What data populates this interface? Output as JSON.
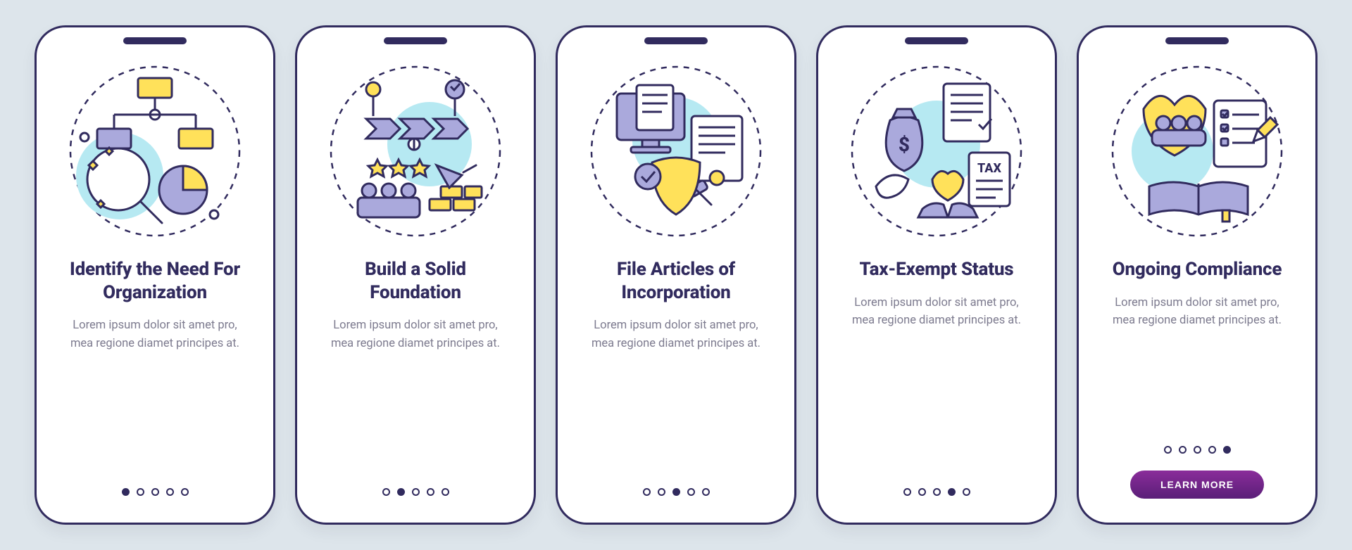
{
  "colors": {
    "ink": "#312b5e",
    "yellow": "#ffe15a",
    "lavender": "#aaa9dc",
    "cyan": "#b6e9f2",
    "page_bg": "#dde5eb",
    "cta_gradient_top": "#8a2d9a",
    "cta_gradient_bottom": "#5a1e78",
    "muted_text": "#7d7b8f"
  },
  "cards": [
    {
      "icon": "org-chart-magnify-icon",
      "title": "Identify the Need For Organization",
      "desc": "Lorem ipsum dolor sit amet pro, mea regione diamet principes at.",
      "active_dot": 0,
      "has_cta": false
    },
    {
      "icon": "foundation-bricks-icon",
      "title": "Build a Solid Foundation",
      "desc": "Lorem ipsum dolor sit amet pro, mea regione diamet principes at.",
      "active_dot": 1,
      "has_cta": false
    },
    {
      "icon": "articles-shield-icon",
      "title": "File Articles of Incorporation",
      "desc": "Lorem ipsum dolor sit amet pro, mea regione diamet principes at.",
      "active_dot": 2,
      "has_cta": false
    },
    {
      "icon": "tax-exempt-icon",
      "title": "Tax-Exempt Status",
      "desc": "Lorem ipsum dolor sit amet pro, mea regione diamet principes at.",
      "active_dot": 3,
      "has_cta": false
    },
    {
      "icon": "compliance-checklist-icon",
      "title": "Ongoing Compliance",
      "desc": "Lorem ipsum dolor sit amet pro, mea regione diamet principes at.",
      "active_dot": 4,
      "has_cta": true
    }
  ],
  "dot_count": 5,
  "cta_label": "LEARN MORE"
}
